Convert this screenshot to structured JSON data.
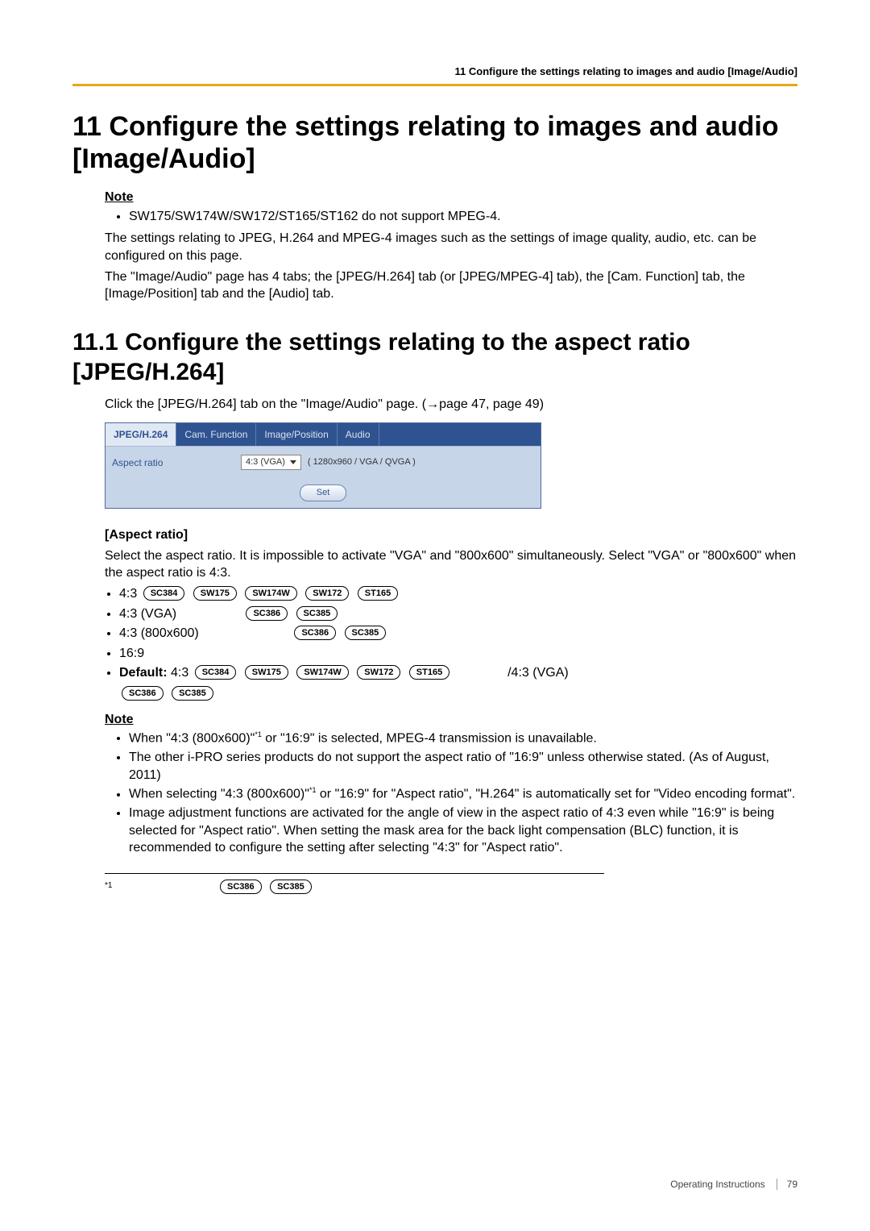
{
  "running_header": "11 Configure the settings relating to images and audio [Image/Audio]",
  "chapter_title": "11  Configure the settings relating to images and audio [Image/Audio]",
  "note_label": "Note",
  "note1_bullet": "SW175/SW174W/SW172/ST165/ST162 do not support MPEG-4.",
  "intro_p1": "The settings relating to JPEG, H.264 and MPEG-4 images such as the settings of image quality, audio, etc. can be configured on this page.",
  "intro_p2": "The \"Image/Audio\" page has 4 tabs; the [JPEG/H.264] tab (or [JPEG/MPEG-4] tab), the [Cam. Function] tab, the [Image/Position] tab and the [Audio] tab.",
  "section_title": "11.1  Configure the settings relating to the aspect ratio [JPEG/H.264]",
  "section_lead_a": "Click the [JPEG/H.264] tab on the \"Image/Audio\" page. (",
  "section_lead_arrow": "→",
  "section_lead_b": "page 47, page 49)",
  "ui": {
    "tabs": [
      "JPEG/H.264",
      "Cam. Function",
      "Image/Position",
      "Audio"
    ],
    "row_label": "Aspect ratio",
    "select_value": "4:3 (VGA)",
    "hint": "( 1280x960 / VGA / QVGA )",
    "set": "Set"
  },
  "aspect_heading": "[Aspect ratio]",
  "aspect_intro": "Select the aspect ratio. It is impossible to activate \"VGA\" and \"800x600\" simultaneously. Select \"VGA\" or \"800x600\" when the aspect ratio is 4:3.",
  "items": {
    "i1": {
      "label": "4:3",
      "pills": [
        "SC384",
        "SW175",
        "SW174W",
        "SW172",
        "ST165"
      ]
    },
    "i2": {
      "label": "4:3 (VGA)",
      "pills": [
        "SC386",
        "SC385"
      ]
    },
    "i3": {
      "label": "4:3 (800x600)",
      "pills": [
        "SC386",
        "SC385"
      ]
    },
    "i4": {
      "label": "16:9"
    },
    "i5": {
      "default_word": "Default:",
      "after_default": " 4:3 ",
      "pills": [
        "SC384",
        "SW175",
        "SW174W",
        "SW172",
        "ST165"
      ],
      "trail": "/4:3 (VGA)",
      "pills2": [
        "SC386",
        "SC385"
      ]
    }
  },
  "note2": {
    "b1a": "When \"4:3 (800x600)\"",
    "b1sup": "*1",
    "b1b": " or \"16:9\" is selected, MPEG-4 transmission is unavailable.",
    "b2": "The other i-PRO series products do not support the aspect ratio of \"16:9\" unless otherwise stated. (As of August, 2011)",
    "b3a": "When selecting \"4:3 (800x600)\"",
    "b3sup": "*1",
    "b3b": " or \"16:9\" for \"Aspect ratio\", \"H.264\" is automatically set for \"Video encoding format\".",
    "b4": "Image adjustment functions are activated for the angle of view in the aspect ratio of 4:3 even while \"16:9\" is being selected for \"Aspect ratio\". When setting the mask area for the back light compensation (BLC) function, it is recommended to configure the setting after selecting \"4:3\" for \"Aspect ratio\"."
  },
  "footnote": {
    "ref": "*1",
    "pills": [
      "SC386",
      "SC385"
    ]
  },
  "footer_label": "Operating Instructions",
  "footer_page": "79"
}
